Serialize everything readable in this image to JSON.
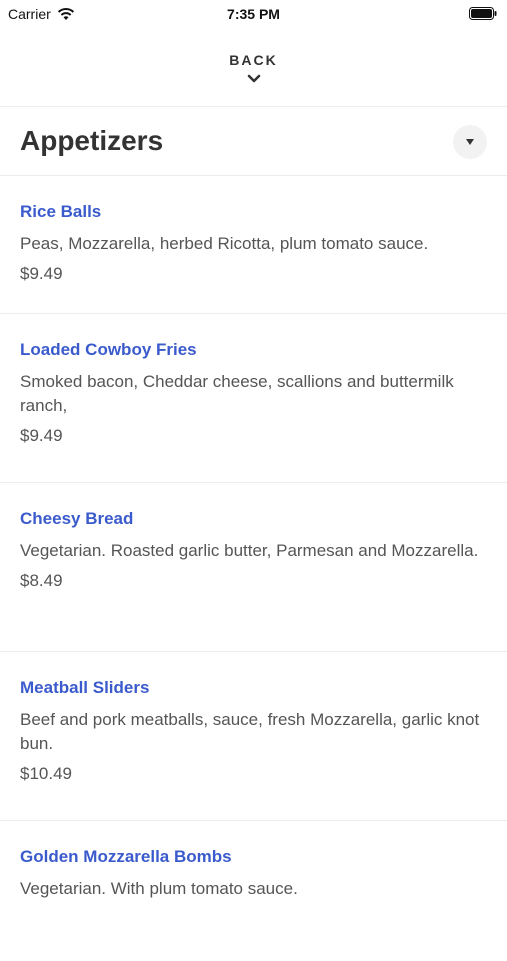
{
  "status_bar": {
    "carrier": "Carrier",
    "time": "7:35 PM"
  },
  "back": {
    "label": "BACK"
  },
  "section": {
    "title": "Appetizers"
  },
  "items": [
    {
      "name": "Rice Balls",
      "description": "Peas, Mozzarella, herbed Ricotta, plum tomato sauce.",
      "price": "$9.49"
    },
    {
      "name": "Loaded Cowboy Fries",
      "description": "Smoked bacon, Cheddar cheese, scallions and buttermilk ranch,",
      "price": "$9.49"
    },
    {
      "name": "Cheesy Bread",
      "description": "Vegetarian. Roasted garlic butter, Parmesan and Mozzarella.",
      "price": "$8.49"
    },
    {
      "name": "Meatball Sliders",
      "description": "Beef and pork meatballs, sauce, fresh Mozzarella, garlic knot bun.",
      "price": "$10.49"
    },
    {
      "name": "Golden Mozzarella Bombs",
      "description": "Vegetarian. With plum tomato sauce.",
      "price": ""
    }
  ]
}
